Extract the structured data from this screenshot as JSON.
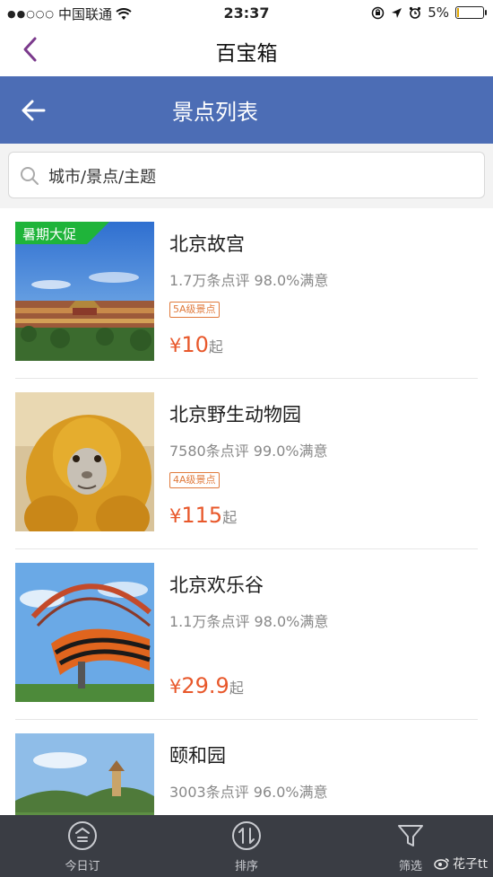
{
  "status_bar": {
    "signal_dots": "●●○○○",
    "carrier": "中国联通",
    "time": "23:37",
    "battery_percent": "5%",
    "battery_level": 0.05,
    "icons": [
      "wifi-icon",
      "orientation-lock-icon",
      "location-arrow-icon",
      "alarm-icon",
      "battery-icon"
    ]
  },
  "nav": {
    "title": "百宝箱",
    "accent_color": "#7b3a8c"
  },
  "header": {
    "title": "景点列表",
    "background_color": "#4c6db5"
  },
  "search": {
    "placeholder": "城市/景点/主题"
  },
  "list": {
    "items": [
      {
        "name": "北京故宫",
        "meta": "1.7万条点评 98.0%满意",
        "badge": "5A级景点",
        "yen": "¥",
        "price": "10",
        "price_suffix": "起",
        "promo": "暑期大促"
      },
      {
        "name": "北京野生动物园",
        "meta": "7580条点评 99.0%满意",
        "badge": "4A级景点",
        "yen": "¥",
        "price": "115",
        "price_suffix": "起"
      },
      {
        "name": "北京欢乐谷",
        "meta": "1.1万条点评 98.0%满意",
        "yen": "¥",
        "price": "29.9",
        "price_suffix": "起"
      },
      {
        "name": "颐和园",
        "meta": "3003条点评 96.0%满意"
      }
    ]
  },
  "bottom_bar": {
    "tabs": [
      {
        "label": "今日订",
        "icon": "today-icon"
      },
      {
        "label": "排序",
        "icon": "sort-icon"
      },
      {
        "label": "筛选",
        "icon": "filter-icon"
      }
    ],
    "watermark": "花子tt"
  },
  "colors": {
    "price": "#e8582b",
    "badge": "#e07a3c",
    "promo": "#1fb43a"
  }
}
